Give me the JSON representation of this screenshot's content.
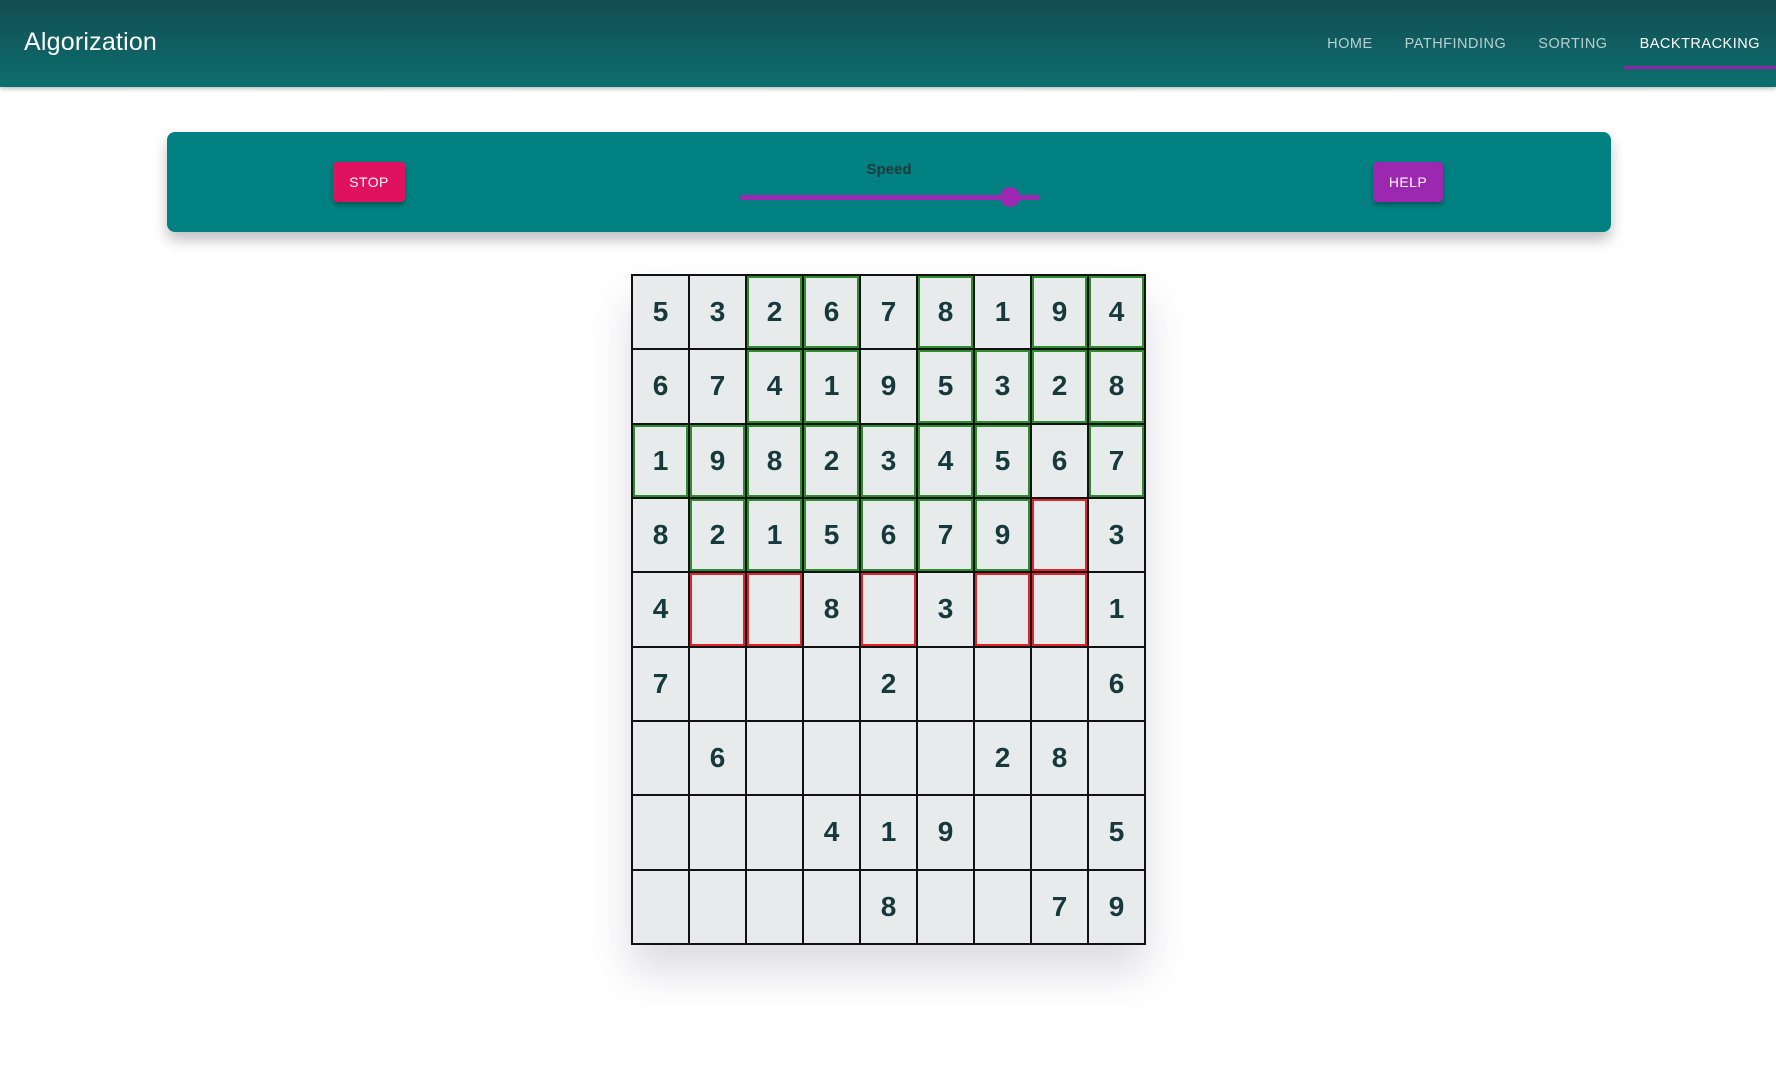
{
  "app": {
    "title": "Algorization",
    "nav": [
      {
        "label": "Home",
        "active": false
      },
      {
        "label": "Pathfinding",
        "active": false
      },
      {
        "label": "Sorting",
        "active": false
      },
      {
        "label": "Backtracking",
        "active": true
      }
    ]
  },
  "controls": {
    "stop_label": "Stop",
    "help_label": "Help",
    "speed_label": "Speed",
    "speed_value": 0.9,
    "accent_color": "#9c27b0",
    "panel_color": "#008080"
  },
  "board": {
    "rows": [
      [
        "5",
        "3",
        "2",
        "6",
        "7",
        "8",
        "1",
        "9",
        "4"
      ],
      [
        "6",
        "7",
        "4",
        "1",
        "9",
        "5",
        "3",
        "2",
        "8"
      ],
      [
        "1",
        "9",
        "8",
        "2",
        "3",
        "4",
        "5",
        "6",
        "7"
      ],
      [
        "8",
        "2",
        "1",
        "5",
        "6",
        "7",
        "9",
        "",
        "3"
      ],
      [
        "4",
        "",
        "",
        "8",
        "",
        "3",
        "",
        "",
        "1"
      ],
      [
        "7",
        "",
        "",
        "",
        "2",
        "",
        "",
        "",
        "6"
      ],
      [
        "",
        "6",
        "",
        "",
        "",
        "",
        "2",
        "8",
        ""
      ],
      [
        "",
        "",
        "",
        "4",
        "1",
        "9",
        "",
        "",
        "5"
      ],
      [
        "",
        "",
        "",
        "",
        "8",
        "",
        "",
        "7",
        "9"
      ]
    ],
    "status": [
      [
        "",
        "",
        "ok",
        "ok",
        "",
        "ok",
        "",
        "ok",
        "ok"
      ],
      [
        "",
        "",
        "ok",
        "ok",
        "",
        "ok",
        "ok",
        "ok",
        "ok"
      ],
      [
        "ok",
        "ok",
        "ok",
        "ok",
        "ok",
        "ok",
        "ok",
        "",
        "ok"
      ],
      [
        "",
        "ok",
        "ok",
        "ok",
        "ok",
        "ok",
        "ok",
        "bad",
        ""
      ],
      [
        "",
        "bad",
        "bad",
        "",
        "bad",
        "",
        "bad",
        "bad",
        ""
      ],
      [
        "",
        "",
        "",
        "",
        "",
        "",
        "",
        "",
        ""
      ],
      [
        "",
        "",
        "",
        "",
        "",
        "",
        "",
        "",
        ""
      ],
      [
        "",
        "",
        "",
        "",
        "",
        "",
        "",
        "",
        ""
      ],
      [
        "",
        "",
        "",
        "",
        "",
        "",
        "",
        "",
        ""
      ]
    ]
  }
}
